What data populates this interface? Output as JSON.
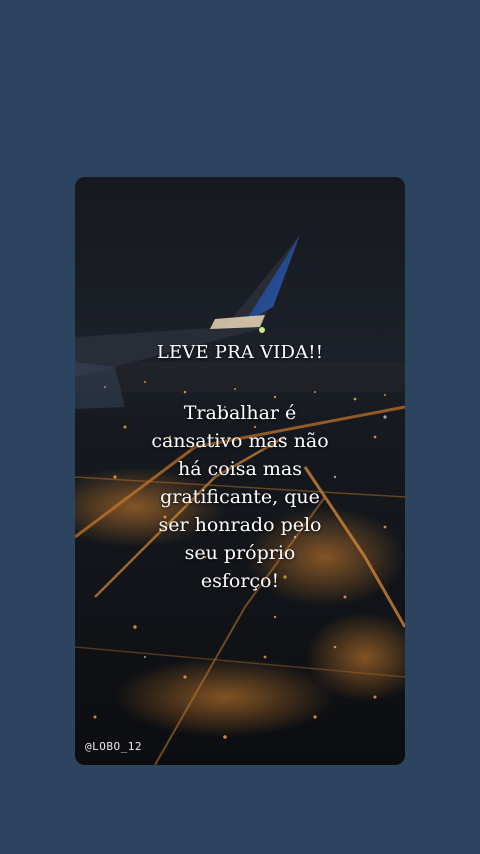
{
  "story": {
    "headline": "LEVE PRA VIDA!!",
    "body": "Trabalhar é\ncansativo mas não\nhá coisa mas\ngratificante, que\nser honrado pelo\nseu próprio\nesforço!",
    "handle": "@LOBO_12"
  },
  "colors": {
    "background": "#2c4460",
    "text": "#ffffff",
    "city_light": "#e08a30"
  }
}
